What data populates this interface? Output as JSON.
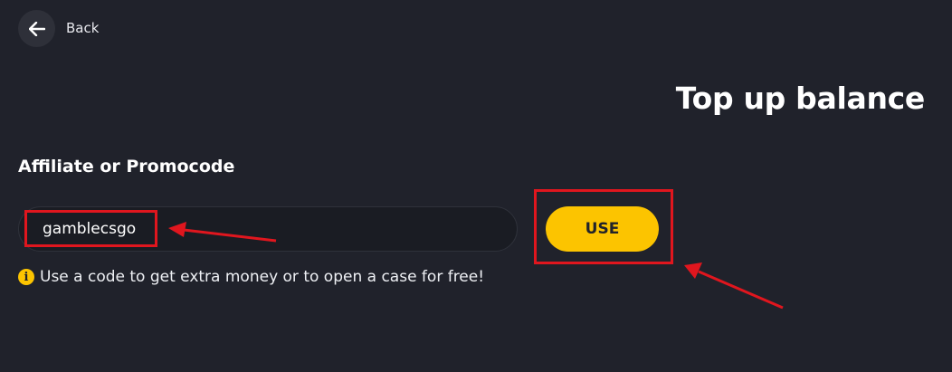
{
  "nav": {
    "back_label": "Back"
  },
  "header": {
    "title": "Top up balance"
  },
  "promo": {
    "section_label": "Affiliate or Promocode",
    "input_value": "gamblecsgo",
    "use_label": "USE",
    "hint": "Use a code to get extra money or to open a case for free!"
  },
  "icons": {
    "back": "arrow-left-icon",
    "info": "info-icon"
  },
  "colors": {
    "background": "#20222b",
    "accent": "#fcc400",
    "annotation": "#e0161e"
  }
}
